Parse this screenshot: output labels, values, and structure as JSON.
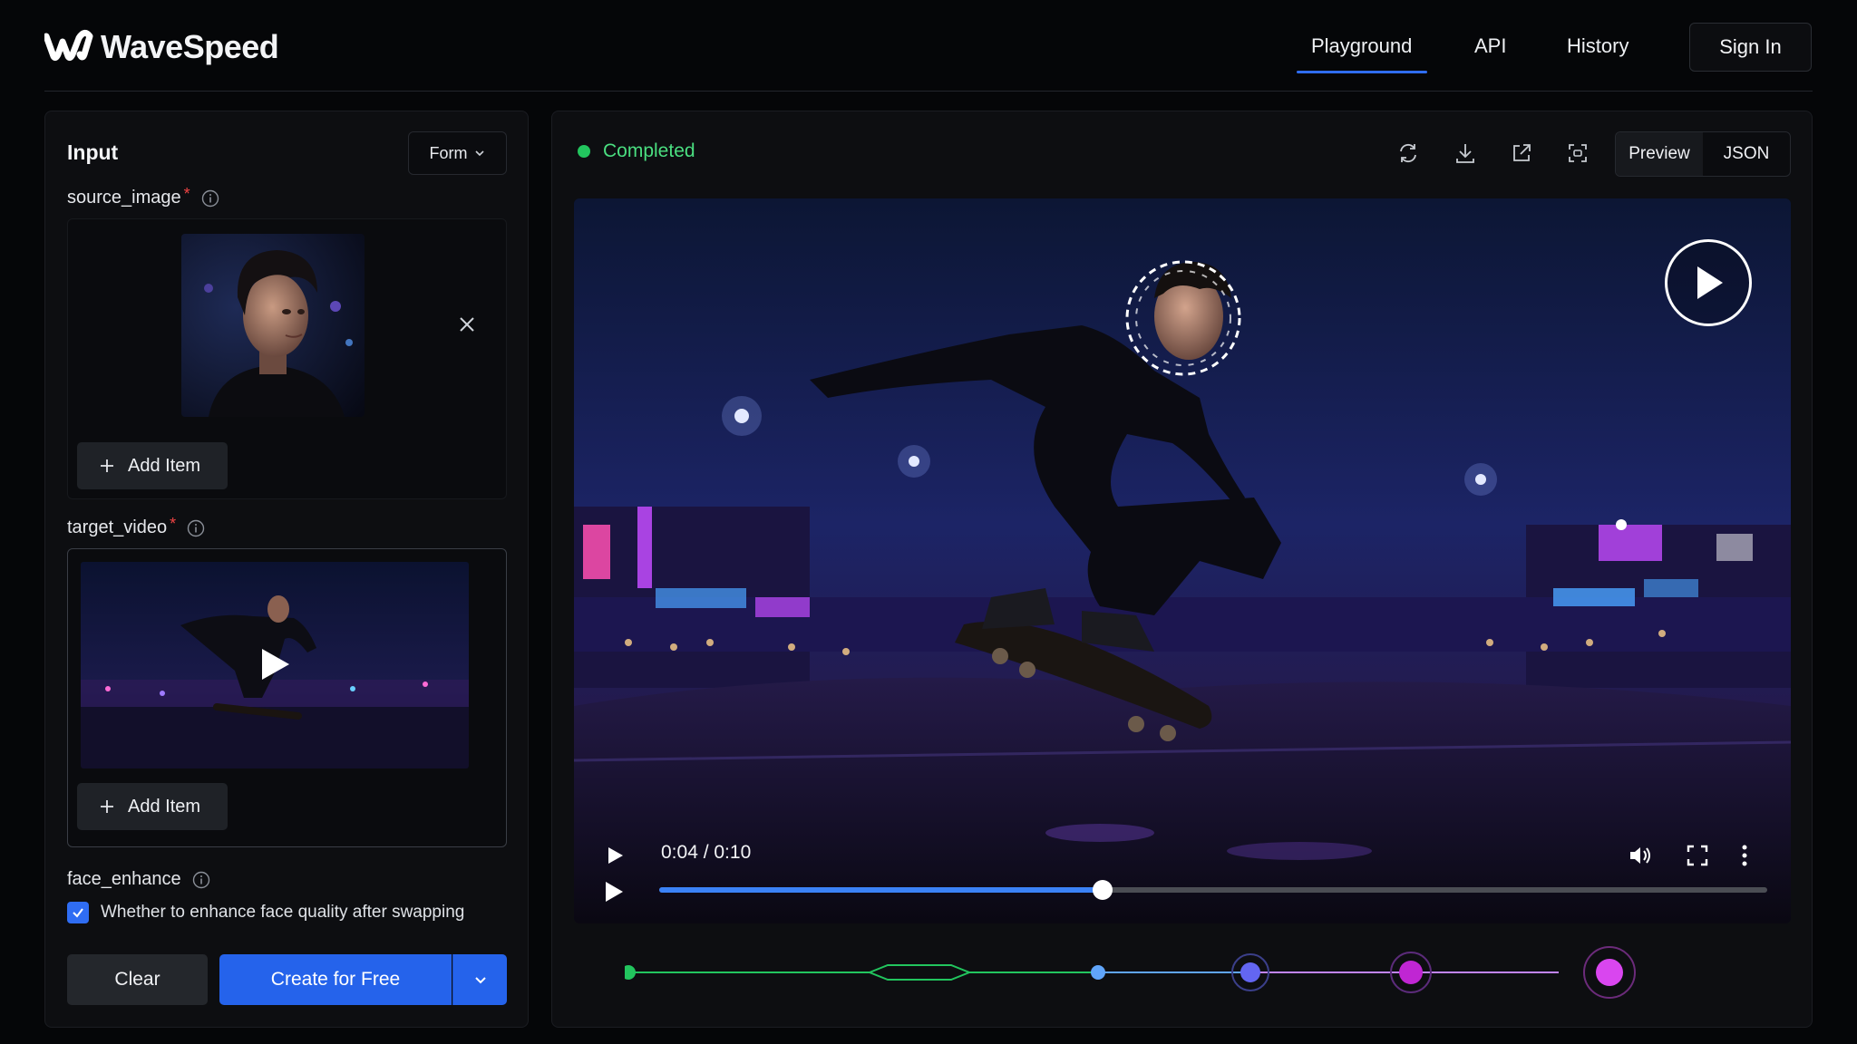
{
  "brand": {
    "name": "WaveSpeed"
  },
  "nav": {
    "playground": "Playground",
    "api": "API",
    "history": "History",
    "sign_in": "Sign In"
  },
  "input_panel": {
    "title": "Input",
    "mode_select": "Form",
    "source_image": {
      "label": "source_image",
      "required_mark": "*",
      "add_item": "Add Item"
    },
    "target_video": {
      "label": "target_video",
      "required_mark": "*",
      "add_item": "Add Item"
    },
    "face_enhance": {
      "label": "face_enhance",
      "checkbox_text": "Whether to enhance face quality after swapping",
      "checked": true
    },
    "buttons": {
      "clear": "Clear",
      "create": "Create for Free"
    }
  },
  "output_panel": {
    "status": "Completed",
    "status_color": "#22c55e",
    "toolbar_icons": [
      "refresh-icon",
      "download-icon",
      "external-link-icon",
      "screenshot-icon"
    ],
    "view_toggle": {
      "preview": "Preview",
      "json": "JSON",
      "selected": "Preview"
    },
    "player": {
      "time": "0:04 / 0:10",
      "progress": 0.4
    }
  },
  "colors": {
    "accent": "#2563eb",
    "success": "#22c55e"
  }
}
